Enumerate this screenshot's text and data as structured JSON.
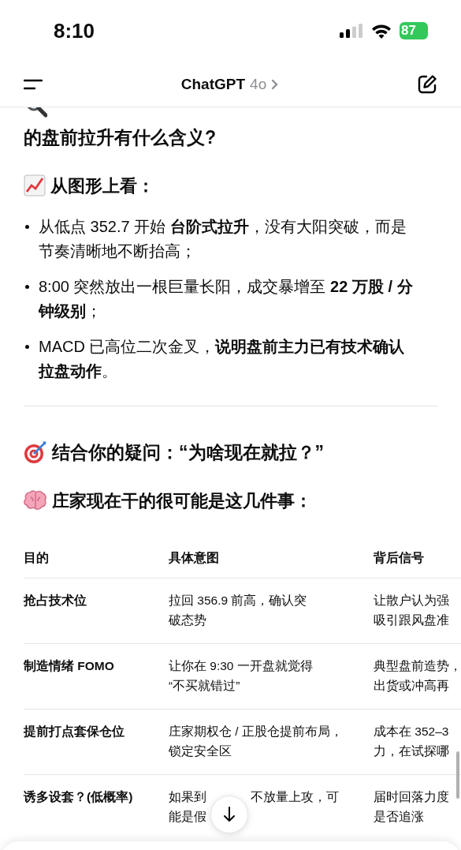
{
  "status_bar": {
    "time": "8:10",
    "battery": "87"
  },
  "header": {
    "title": "ChatGPT",
    "model": "4o"
  },
  "sections": [
    {
      "kind": "heading",
      "text": "的盘前拉升有什么含义?"
    },
    {
      "kind": "subheading",
      "text": "从图形上看："
    },
    {
      "kind": "bullets",
      "items": [
        "从低点 352.7 开始 **台阶式拉升**，没有大阳突破，而是节奏清晰地不断抬高；",
        "8:00 突然放出一根巨量长阳，成交暴增至 **22 万股 / 分钟级别**；",
        "MACD 已高位二次金叉，**说明盘前主力已有技术确认拉盘动作**。"
      ]
    },
    {
      "kind": "divider"
    },
    {
      "kind": "heading",
      "text": "结合你的疑问：“为啥现在就拉？”"
    },
    {
      "kind": "subheading",
      "text": "庄家现在干的很可能是这几件事："
    }
  ],
  "table": {
    "columns": [
      "目的",
      "具体意图",
      "背后信号"
    ],
    "rows": [
      [
        "抢占技术位",
        [
          "拉回 356.9 前高，确认突",
          "破态势"
        ],
        [
          "让散户认为强",
          "吸引跟风盘准"
        ]
      ],
      [
        "制造情绪 FOMO",
        [
          "让你在 9:30 一开盘就觉得",
          "“不买就错过”"
        ],
        [
          "典型盘前造势，",
          "出货或冲高再"
        ]
      ],
      [
        "提前打点套保仓位",
        [
          "庄家期权仓 / 正股仓提前布局，",
          "锁定安全区"
        ],
        [
          "成本在 352–3",
          "力，在试探哪"
        ]
      ],
      [
        "诱多设套？(低概率)",
        [
          [
            "如果到",
            "不放量上攻，可"
          ],
          [
            "能是假"
          ]
        ],
        [
          "届时回落力度",
          "是否追涨"
        ]
      ]
    ]
  }
}
